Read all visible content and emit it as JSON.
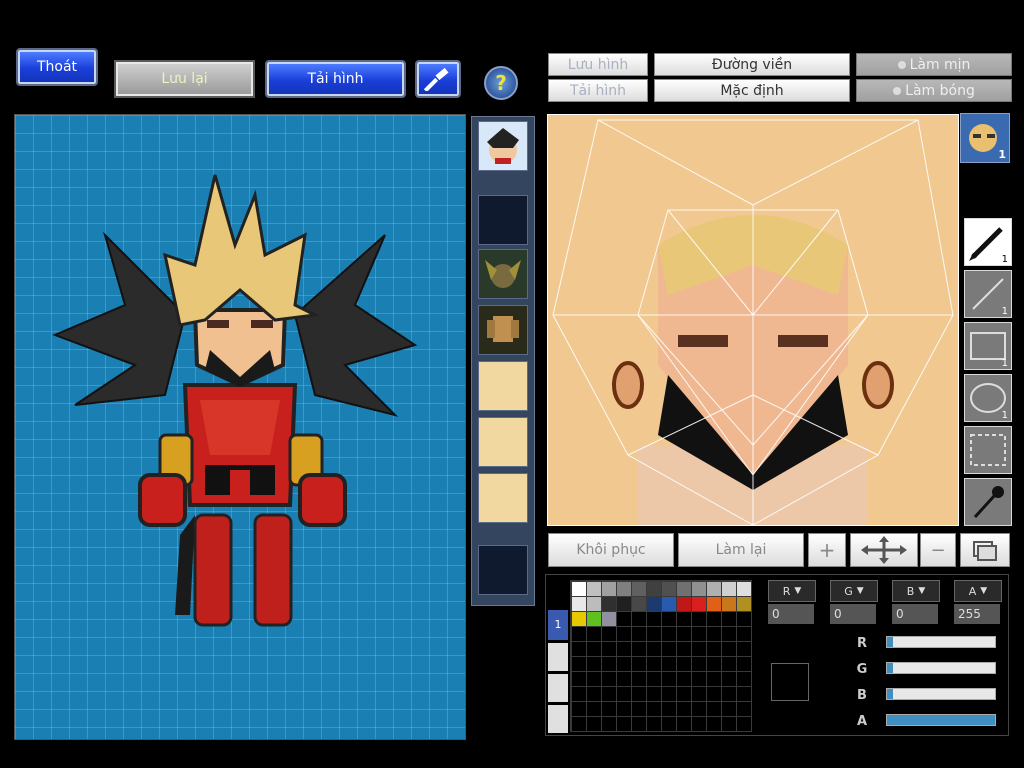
{
  "top_buttons": {
    "exit": "Thoát",
    "save": "Lưu lại",
    "reload": "Tải hình"
  },
  "help_icon": "?",
  "face_toolbar": {
    "save_image": "Lưu hình",
    "load_image": "Tải hình",
    "outline": "Đường viền",
    "default": "Mặc định",
    "smooth": "Làm mịn",
    "shine": "Làm bóng"
  },
  "head_thumb_count": "1",
  "tools": [
    {
      "name": "pen",
      "count": "1"
    },
    {
      "name": "line",
      "count": "1"
    },
    {
      "name": "rectangle",
      "count": "1"
    },
    {
      "name": "ellipse",
      "count": "1"
    },
    {
      "name": "selection",
      "count": ""
    },
    {
      "name": "eyedropper",
      "count": ""
    }
  ],
  "bottom_toolbar": {
    "restore": "Khôi phục",
    "redo": "Làm lại",
    "plus": "+",
    "minus": "−"
  },
  "palette_tab": "1",
  "channels": {
    "r_value": "0",
    "g_value": "0",
    "b_value": "0",
    "a_value": "255"
  },
  "slider_levels": {
    "r": 0.0,
    "g": 0.0,
    "b": 0.0,
    "a": 1.0
  },
  "colors": {
    "stage_blue": "#1a7fb3",
    "button_blue": "#1a3fd9",
    "skin": "#f0c890",
    "hair": "#e8c878",
    "armor_red": "#c8201c"
  },
  "swatches": [
    "#ffffff",
    "#c0c0c0",
    "#a0a0a0",
    "#808080",
    "#606060",
    "#404040",
    "#505050",
    "#707070",
    "#909090",
    "#b0b0b0",
    "#d0d0d0",
    "#e0e0e0",
    "#e8e8e8",
    "#bcbcbc",
    "#303030",
    "#202020",
    "#484848",
    "#1a3a70",
    "#2a5ab0",
    "#c01818",
    "#d82020",
    "#e06018",
    "#c87818",
    "#b09020",
    "#e8c800",
    "#60c020",
    "#9090a0"
  ]
}
